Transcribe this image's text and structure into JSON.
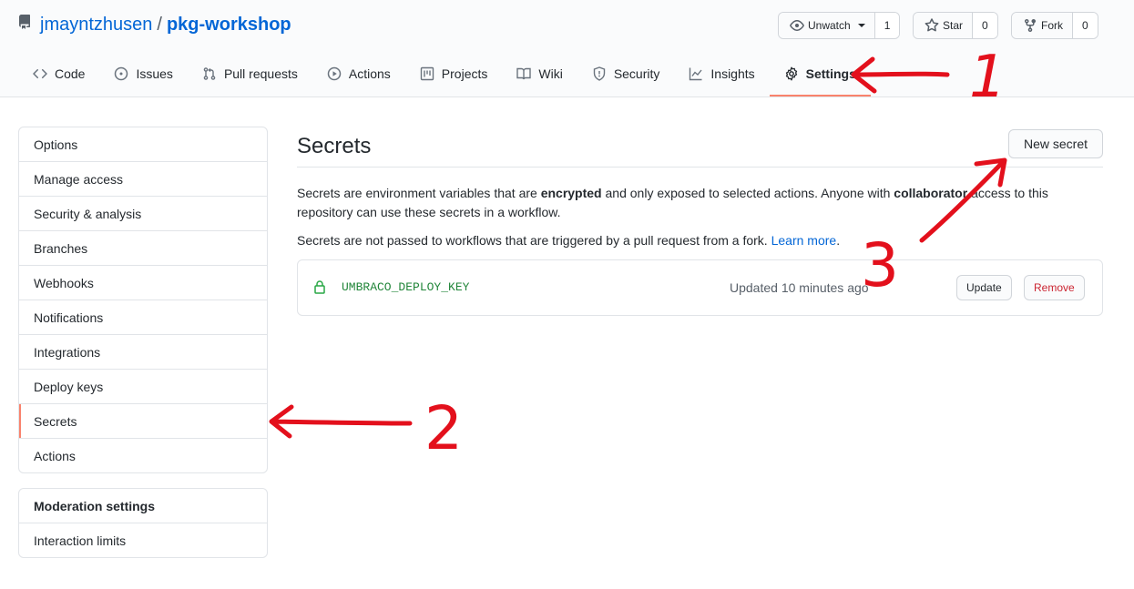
{
  "repo": {
    "owner": "jmayntzhusen",
    "separator": "/",
    "name": "pkg-workshop"
  },
  "actions": {
    "watch": {
      "label": "Unwatch",
      "count": "1"
    },
    "star": {
      "label": "Star",
      "count": "0"
    },
    "fork": {
      "label": "Fork",
      "count": "0"
    }
  },
  "tabs": [
    {
      "label": "Code",
      "icon": "code-icon"
    },
    {
      "label": "Issues",
      "icon": "issue-icon"
    },
    {
      "label": "Pull requests",
      "icon": "pull-request-icon"
    },
    {
      "label": "Actions",
      "icon": "play-icon"
    },
    {
      "label": "Projects",
      "icon": "project-icon"
    },
    {
      "label": "Wiki",
      "icon": "book-icon"
    },
    {
      "label": "Security",
      "icon": "shield-icon"
    },
    {
      "label": "Insights",
      "icon": "graph-icon"
    },
    {
      "label": "Settings",
      "icon": "gear-icon",
      "selected": true
    }
  ],
  "sidebar": {
    "items": [
      "Options",
      "Manage access",
      "Security & analysis",
      "Branches",
      "Webhooks",
      "Notifications",
      "Integrations",
      "Deploy keys",
      "Secrets",
      "Actions"
    ],
    "selected": "Secrets",
    "moderation": {
      "heading": "Moderation settings",
      "items": [
        "Interaction limits"
      ]
    }
  },
  "main": {
    "title": "Secrets",
    "new_secret_label": "New secret",
    "description": {
      "p1_part1": "Secrets are environment variables that are ",
      "p1_bold1": "encrypted",
      "p1_part2": " and only exposed to selected actions. Anyone with ",
      "p1_bold2": "collaborator",
      "p1_part3": " access to this repository can use these secrets in a workflow.",
      "p2_text": "Secrets are not passed to workflows that are triggered by a pull request from a fork. ",
      "p2_link": "Learn more",
      "p2_end": "."
    },
    "secret": {
      "name": "UMBRACO_DEPLOY_KEY",
      "updated": "Updated 10 minutes ago",
      "update_label": "Update",
      "remove_label": "Remove"
    }
  },
  "annotations": {
    "step1": "1",
    "step2": "2",
    "step3": "3",
    "color": "#e3101c"
  },
  "colors": {
    "link": "#0366d6",
    "selected_underline": "#f9826c",
    "secret_name": "#22863a",
    "remove": "#cb2431"
  }
}
